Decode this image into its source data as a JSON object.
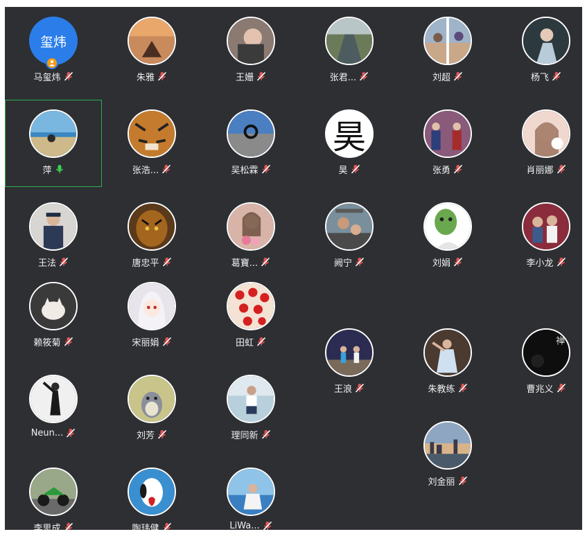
{
  "colors": {
    "panel_bg": "#2d2f33",
    "active_border": "#2fae4f",
    "muted_mic": "#e35757",
    "active_mic": "#3ccf4e",
    "avatar_blue": "#2b7de9",
    "host_badge": "#f39c12"
  },
  "participants": [
    {
      "name": "马玺炜",
      "avatar_text": "玺炜",
      "avatar_icon": "text-avatar",
      "host": true,
      "mic": "muted"
    },
    {
      "name": "朱雅",
      "avatar_icon": "sunset-heart-photo",
      "mic": "muted"
    },
    {
      "name": "王姗",
      "avatar_icon": "portrait-photo",
      "mic": "muted"
    },
    {
      "name": "张君...",
      "avatar_icon": "river-photo",
      "mic": "muted"
    },
    {
      "name": "刘超",
      "avatar_icon": "collage-photo",
      "mic": "muted"
    },
    {
      "name": "杨飞",
      "avatar_icon": "girl-photo",
      "mic": "muted"
    },
    {
      "name": "萍",
      "avatar_icon": "beach-photo",
      "mic": "active",
      "active_speaker": true
    },
    {
      "name": "张浩...",
      "avatar_icon": "tiger-photo",
      "mic": "muted"
    },
    {
      "name": "吴松霖",
      "avatar_icon": "sea-ring-photo",
      "mic": "muted"
    },
    {
      "name": "昊",
      "avatar_text": "昊",
      "avatar_icon": "calligraphy-avatar",
      "mic": "muted"
    },
    {
      "name": "张勇",
      "avatar_icon": "boxing-photo",
      "mic": "muted"
    },
    {
      "name": "肖丽娜",
      "avatar_icon": "selfie-photo",
      "mic": "muted"
    },
    {
      "name": "王法",
      "avatar_icon": "officer-photo",
      "mic": "muted"
    },
    {
      "name": "唐忠平",
      "avatar_icon": "tiger-face-photo",
      "mic": "muted"
    },
    {
      "name": "葛寶...",
      "avatar_icon": "woman-flowers-photo",
      "mic": "muted"
    },
    {
      "name": "阙宁",
      "avatar_icon": "family-photo",
      "mic": "muted"
    },
    {
      "name": "刘娟",
      "avatar_icon": "frog-mask-photo",
      "mic": "muted"
    },
    {
      "name": "李小龙",
      "avatar_icon": "kids-photo",
      "mic": "muted"
    },
    {
      "name": "赖筱菊",
      "avatar_icon": "cat-photo",
      "mic": "muted"
    },
    {
      "name": "宋丽娟",
      "avatar_icon": "anime-girl-photo",
      "mic": "muted"
    },
    {
      "name": "田虹",
      "avatar_icon": "lanterns-photo",
      "mic": "muted"
    },
    {
      "name": "王浪",
      "avatar_icon": "dance-photo",
      "mic": "muted"
    },
    {
      "name": "朱教练",
      "avatar_icon": "dancer-photo",
      "mic": "muted"
    },
    {
      "name": "曹兆义",
      "avatar_icon": "dark-calligraphy-photo",
      "mic": "muted"
    },
    {
      "name": "Neun...",
      "avatar_icon": "dancer-bw-photo",
      "mic": "muted"
    },
    {
      "name": "刘芳",
      "avatar_icon": "totoro-photo",
      "mic": "muted"
    },
    {
      "name": "理同新",
      "avatar_icon": "lake-man-photo",
      "mic": "muted"
    },
    {
      "name": "刘金丽",
      "avatar_icon": "skyline-photo",
      "mic": "muted"
    },
    {
      "name": "李思成",
      "avatar_icon": "motorbike-photo",
      "mic": "muted"
    },
    {
      "name": "陶玮健",
      "avatar_icon": "snoopy-photo",
      "mic": "muted"
    },
    {
      "name": "LiWa...",
      "avatar_icon": "seaside-woman-photo",
      "mic": "muted"
    }
  ]
}
